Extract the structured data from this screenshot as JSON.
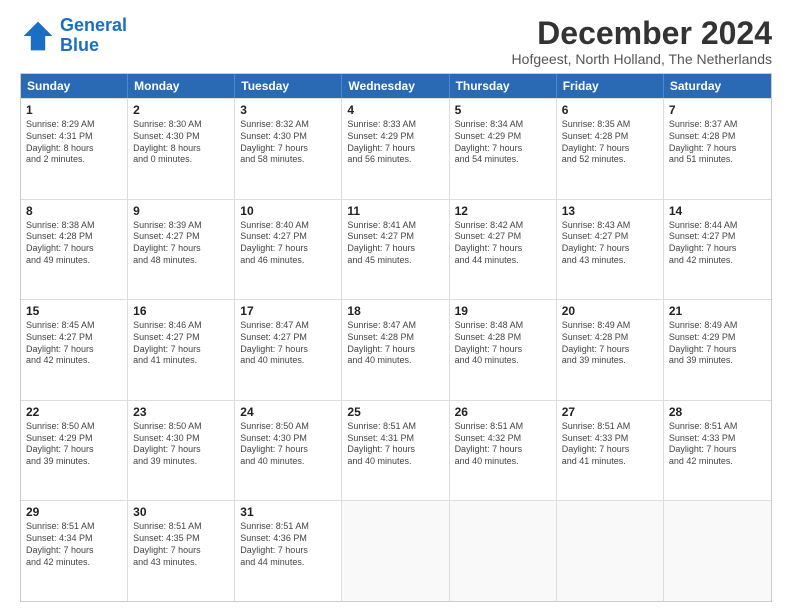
{
  "logo": {
    "text_general": "General",
    "text_blue": "Blue"
  },
  "header": {
    "title": "December 2024",
    "subtitle": "Hofgeest, North Holland, The Netherlands"
  },
  "days_of_week": [
    "Sunday",
    "Monday",
    "Tuesday",
    "Wednesday",
    "Thursday",
    "Friday",
    "Saturday"
  ],
  "weeks": [
    [
      {
        "day": "1",
        "lines": [
          "Sunrise: 8:29 AM",
          "Sunset: 4:31 PM",
          "Daylight: 8 hours",
          "and 2 minutes."
        ]
      },
      {
        "day": "2",
        "lines": [
          "Sunrise: 8:30 AM",
          "Sunset: 4:30 PM",
          "Daylight: 8 hours",
          "and 0 minutes."
        ]
      },
      {
        "day": "3",
        "lines": [
          "Sunrise: 8:32 AM",
          "Sunset: 4:30 PM",
          "Daylight: 7 hours",
          "and 58 minutes."
        ]
      },
      {
        "day": "4",
        "lines": [
          "Sunrise: 8:33 AM",
          "Sunset: 4:29 PM",
          "Daylight: 7 hours",
          "and 56 minutes."
        ]
      },
      {
        "day": "5",
        "lines": [
          "Sunrise: 8:34 AM",
          "Sunset: 4:29 PM",
          "Daylight: 7 hours",
          "and 54 minutes."
        ]
      },
      {
        "day": "6",
        "lines": [
          "Sunrise: 8:35 AM",
          "Sunset: 4:28 PM",
          "Daylight: 7 hours",
          "and 52 minutes."
        ]
      },
      {
        "day": "7",
        "lines": [
          "Sunrise: 8:37 AM",
          "Sunset: 4:28 PM",
          "Daylight: 7 hours",
          "and 51 minutes."
        ]
      }
    ],
    [
      {
        "day": "8",
        "lines": [
          "Sunrise: 8:38 AM",
          "Sunset: 4:28 PM",
          "Daylight: 7 hours",
          "and 49 minutes."
        ]
      },
      {
        "day": "9",
        "lines": [
          "Sunrise: 8:39 AM",
          "Sunset: 4:27 PM",
          "Daylight: 7 hours",
          "and 48 minutes."
        ]
      },
      {
        "day": "10",
        "lines": [
          "Sunrise: 8:40 AM",
          "Sunset: 4:27 PM",
          "Daylight: 7 hours",
          "and 46 minutes."
        ]
      },
      {
        "day": "11",
        "lines": [
          "Sunrise: 8:41 AM",
          "Sunset: 4:27 PM",
          "Daylight: 7 hours",
          "and 45 minutes."
        ]
      },
      {
        "day": "12",
        "lines": [
          "Sunrise: 8:42 AM",
          "Sunset: 4:27 PM",
          "Daylight: 7 hours",
          "and 44 minutes."
        ]
      },
      {
        "day": "13",
        "lines": [
          "Sunrise: 8:43 AM",
          "Sunset: 4:27 PM",
          "Daylight: 7 hours",
          "and 43 minutes."
        ]
      },
      {
        "day": "14",
        "lines": [
          "Sunrise: 8:44 AM",
          "Sunset: 4:27 PM",
          "Daylight: 7 hours",
          "and 42 minutes."
        ]
      }
    ],
    [
      {
        "day": "15",
        "lines": [
          "Sunrise: 8:45 AM",
          "Sunset: 4:27 PM",
          "Daylight: 7 hours",
          "and 42 minutes."
        ]
      },
      {
        "day": "16",
        "lines": [
          "Sunrise: 8:46 AM",
          "Sunset: 4:27 PM",
          "Daylight: 7 hours",
          "and 41 minutes."
        ]
      },
      {
        "day": "17",
        "lines": [
          "Sunrise: 8:47 AM",
          "Sunset: 4:27 PM",
          "Daylight: 7 hours",
          "and 40 minutes."
        ]
      },
      {
        "day": "18",
        "lines": [
          "Sunrise: 8:47 AM",
          "Sunset: 4:28 PM",
          "Daylight: 7 hours",
          "and 40 minutes."
        ]
      },
      {
        "day": "19",
        "lines": [
          "Sunrise: 8:48 AM",
          "Sunset: 4:28 PM",
          "Daylight: 7 hours",
          "and 40 minutes."
        ]
      },
      {
        "day": "20",
        "lines": [
          "Sunrise: 8:49 AM",
          "Sunset: 4:28 PM",
          "Daylight: 7 hours",
          "and 39 minutes."
        ]
      },
      {
        "day": "21",
        "lines": [
          "Sunrise: 8:49 AM",
          "Sunset: 4:29 PM",
          "Daylight: 7 hours",
          "and 39 minutes."
        ]
      }
    ],
    [
      {
        "day": "22",
        "lines": [
          "Sunrise: 8:50 AM",
          "Sunset: 4:29 PM",
          "Daylight: 7 hours",
          "and 39 minutes."
        ]
      },
      {
        "day": "23",
        "lines": [
          "Sunrise: 8:50 AM",
          "Sunset: 4:30 PM",
          "Daylight: 7 hours",
          "and 39 minutes."
        ]
      },
      {
        "day": "24",
        "lines": [
          "Sunrise: 8:50 AM",
          "Sunset: 4:30 PM",
          "Daylight: 7 hours",
          "and 40 minutes."
        ]
      },
      {
        "day": "25",
        "lines": [
          "Sunrise: 8:51 AM",
          "Sunset: 4:31 PM",
          "Daylight: 7 hours",
          "and 40 minutes."
        ]
      },
      {
        "day": "26",
        "lines": [
          "Sunrise: 8:51 AM",
          "Sunset: 4:32 PM",
          "Daylight: 7 hours",
          "and 40 minutes."
        ]
      },
      {
        "day": "27",
        "lines": [
          "Sunrise: 8:51 AM",
          "Sunset: 4:33 PM",
          "Daylight: 7 hours",
          "and 41 minutes."
        ]
      },
      {
        "day": "28",
        "lines": [
          "Sunrise: 8:51 AM",
          "Sunset: 4:33 PM",
          "Daylight: 7 hours",
          "and 42 minutes."
        ]
      }
    ],
    [
      {
        "day": "29",
        "lines": [
          "Sunrise: 8:51 AM",
          "Sunset: 4:34 PM",
          "Daylight: 7 hours",
          "and 42 minutes."
        ]
      },
      {
        "day": "30",
        "lines": [
          "Sunrise: 8:51 AM",
          "Sunset: 4:35 PM",
          "Daylight: 7 hours",
          "and 43 minutes."
        ]
      },
      {
        "day": "31",
        "lines": [
          "Sunrise: 8:51 AM",
          "Sunset: 4:36 PM",
          "Daylight: 7 hours",
          "and 44 minutes."
        ]
      },
      {
        "day": "",
        "lines": []
      },
      {
        "day": "",
        "lines": []
      },
      {
        "day": "",
        "lines": []
      },
      {
        "day": "",
        "lines": []
      }
    ]
  ]
}
